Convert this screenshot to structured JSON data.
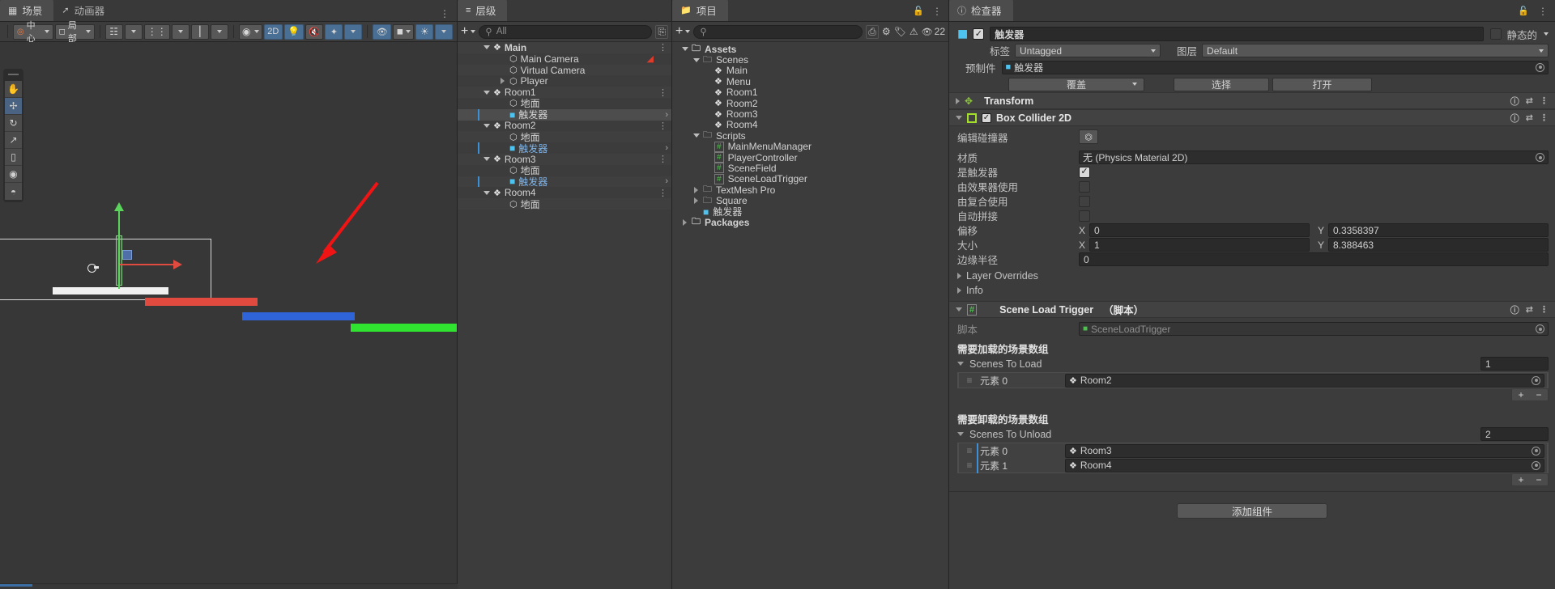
{
  "scene_panel": {
    "tabs": [
      {
        "label": "场景",
        "icon": "grid-icon",
        "active": true
      },
      {
        "label": "动画器",
        "icon": "animator-icon",
        "active": false
      }
    ],
    "toolbar": {
      "pivot_mode": "中心",
      "space_mode": "局部",
      "snap_label": "",
      "mode_2d": "2D",
      "count_badge": ""
    },
    "tools": [
      "hand-tool",
      "move-tool",
      "rotate-tool",
      "scale-tool",
      "rect-tool",
      "transform-tool",
      "custom-tool"
    ],
    "gizmo": {
      "axis_x_color": "#e04a3f",
      "axis_y_color": "#5ad45a",
      "cube_color": "#4f6fa8"
    },
    "platforms": [
      {
        "name": "red-platform",
        "color": "#e04a3f"
      },
      {
        "name": "blue-platform",
        "color": "#2f64d8"
      },
      {
        "name": "green-platform",
        "color": "#31e331"
      }
    ],
    "annotation_arrow_color": "#f01414"
  },
  "hierarchy": {
    "tab_label": "层级",
    "add_label": "+",
    "search_placeholder": "All",
    "items": [
      {
        "label": "Main",
        "depth": 1,
        "icon": "unity-scene-icon",
        "expanded": true,
        "bold": true,
        "kebab": true,
        "selected": false,
        "marker": false,
        "blue": false
      },
      {
        "label": "Main Camera",
        "depth": 2,
        "icon": "gameobject-icon",
        "expanded": null,
        "bold": false,
        "kebab": false,
        "selected": false,
        "marker": false,
        "blue": false,
        "badge": "camera-audio-icon"
      },
      {
        "label": "Virtual Camera",
        "depth": 2,
        "icon": "gameobject-icon",
        "expanded": null,
        "bold": false,
        "kebab": false,
        "selected": false,
        "marker": false,
        "blue": false
      },
      {
        "label": "Player",
        "depth": 2,
        "icon": "gameobject-icon",
        "expanded": false,
        "bold": false,
        "kebab": false,
        "selected": false,
        "marker": false,
        "blue": false
      },
      {
        "label": "Room1",
        "depth": 1,
        "icon": "unity-scene-icon",
        "expanded": true,
        "bold": false,
        "kebab": true,
        "selected": false,
        "marker": false,
        "blue": false
      },
      {
        "label": "地面",
        "depth": 2,
        "icon": "gameobject-icon",
        "expanded": null,
        "bold": false,
        "kebab": false,
        "selected": false,
        "marker": false,
        "blue": false
      },
      {
        "label": "触发器",
        "depth": 2,
        "icon": "prefab-icon",
        "expanded": null,
        "bold": false,
        "kebab": false,
        "selected": true,
        "marker": true,
        "blue": false,
        "chevron_right": true
      },
      {
        "label": "Room2",
        "depth": 1,
        "icon": "unity-scene-icon",
        "expanded": true,
        "bold": false,
        "kebab": true,
        "selected": false,
        "marker": false,
        "blue": false
      },
      {
        "label": "地面",
        "depth": 2,
        "icon": "gameobject-icon",
        "expanded": null,
        "bold": false,
        "kebab": false,
        "selected": false,
        "marker": false,
        "blue": false
      },
      {
        "label": "触发器",
        "depth": 2,
        "icon": "prefab-icon",
        "expanded": null,
        "bold": false,
        "kebab": false,
        "selected": false,
        "marker": true,
        "blue": true,
        "chevron_right": true
      },
      {
        "label": "Room3",
        "depth": 1,
        "icon": "unity-scene-icon",
        "expanded": true,
        "bold": false,
        "kebab": true,
        "selected": false,
        "marker": false,
        "blue": false
      },
      {
        "label": "地面",
        "depth": 2,
        "icon": "gameobject-icon",
        "expanded": null,
        "bold": false,
        "kebab": false,
        "selected": false,
        "marker": false,
        "blue": false
      },
      {
        "label": "触发器",
        "depth": 2,
        "icon": "prefab-icon",
        "expanded": null,
        "bold": false,
        "kebab": false,
        "selected": false,
        "marker": true,
        "blue": true,
        "chevron_right": true
      },
      {
        "label": "Room4",
        "depth": 1,
        "icon": "unity-scene-icon",
        "expanded": true,
        "bold": false,
        "kebab": true,
        "selected": false,
        "marker": false,
        "blue": false
      },
      {
        "label": "地面",
        "depth": 2,
        "icon": "gameobject-icon",
        "expanded": null,
        "bold": false,
        "kebab": false,
        "selected": false,
        "marker": false,
        "blue": false
      }
    ]
  },
  "project": {
    "tab_label": "项目",
    "add_label": "+",
    "search_placeholder": "",
    "badge_count": "22",
    "items": [
      {
        "label": "Assets",
        "depth": 0,
        "icon": "folder-icon",
        "expanded": true,
        "bold": true
      },
      {
        "label": "Scenes",
        "depth": 1,
        "icon": "folder-icon",
        "expanded": true,
        "bold": false
      },
      {
        "label": "Main",
        "depth": 2,
        "icon": "unity-scene-icon",
        "expanded": null,
        "bold": false
      },
      {
        "label": "Menu",
        "depth": 2,
        "icon": "unity-scene-icon",
        "expanded": null,
        "bold": false
      },
      {
        "label": "Room1",
        "depth": 2,
        "icon": "unity-scene-icon",
        "expanded": null,
        "bold": false
      },
      {
        "label": "Room2",
        "depth": 2,
        "icon": "unity-scene-icon",
        "expanded": null,
        "bold": false
      },
      {
        "label": "Room3",
        "depth": 2,
        "icon": "unity-scene-icon",
        "expanded": null,
        "bold": false
      },
      {
        "label": "Room4",
        "depth": 2,
        "icon": "unity-scene-icon",
        "expanded": null,
        "bold": false
      },
      {
        "label": "Scripts",
        "depth": 1,
        "icon": "folder-icon",
        "expanded": true,
        "bold": false
      },
      {
        "label": "MainMenuManager",
        "depth": 2,
        "icon": "script-icon",
        "expanded": null,
        "bold": false
      },
      {
        "label": "PlayerController",
        "depth": 2,
        "icon": "script-icon",
        "expanded": null,
        "bold": false
      },
      {
        "label": "SceneField",
        "depth": 2,
        "icon": "script-icon",
        "expanded": null,
        "bold": false
      },
      {
        "label": "SceneLoadTrigger",
        "depth": 2,
        "icon": "script-icon",
        "expanded": null,
        "bold": false
      },
      {
        "label": "TextMesh Pro",
        "depth": 1,
        "icon": "folder-icon",
        "expanded": false,
        "bold": false
      },
      {
        "label": "Square",
        "depth": 1,
        "icon": "folder-icon",
        "expanded": false,
        "bold": false
      },
      {
        "label": "触发器",
        "depth": 1,
        "icon": "prefab-icon",
        "expanded": null,
        "bold": false
      },
      {
        "label": "Packages",
        "depth": 0,
        "icon": "folder-icon",
        "expanded": false,
        "bold": true
      }
    ]
  },
  "inspector": {
    "tab_label": "检查器",
    "object": {
      "enabled": true,
      "name": "触发器",
      "static_label": "静态的",
      "static_checked": false,
      "tag_label": "标签",
      "tag_value": "Untagged",
      "layer_label": "图层",
      "layer_value": "Default",
      "prefab_label": "预制件",
      "prefab_value": "触发器",
      "overrides_label": "覆盖",
      "select_label": "选择",
      "open_label": "打开"
    },
    "transform": {
      "title": "Transform",
      "expanded": false
    },
    "box_collider": {
      "title": "Box Collider 2D",
      "enabled": true,
      "expanded": true,
      "edit_collider_label": "编辑碰撞器",
      "material_label": "材质",
      "material_value": "无 (Physics Material 2D)",
      "is_trigger_label": "是触发器",
      "is_trigger_checked": true,
      "used_by_effector_label": "由效果器使用",
      "used_by_effector_checked": false,
      "used_by_composite_label": "由复合使用",
      "used_by_composite_checked": false,
      "auto_tiling_label": "自动拼接",
      "auto_tiling_checked": false,
      "offset_label": "偏移",
      "offset_x": "0",
      "offset_y": "0.3358397",
      "size_label": "大小",
      "size_x": "1",
      "size_y": "8.388463",
      "edge_radius_label": "边缘半径",
      "edge_radius_value": "0",
      "layer_overrides_label": "Layer Overrides",
      "info_label": "Info"
    },
    "scene_load_trigger": {
      "title": "Scene Load Trigger",
      "title_suffix": "（脚本）",
      "expanded": true,
      "script_label": "脚本",
      "script_value": "SceneLoadTrigger",
      "load_section_title": "需要加载的场景数组",
      "load_array_label": "Scenes To Load",
      "load_array_size": "1",
      "load_elements": [
        {
          "label": "元素 0",
          "value": "Room2",
          "marker": false
        }
      ],
      "unload_section_title": "需要卸载的场景数组",
      "unload_array_label": "Scenes To Unload",
      "unload_array_size": "2",
      "unload_elements": [
        {
          "label": "元素 0",
          "value": "Room3",
          "marker": true
        },
        {
          "label": "元素 1",
          "value": "Room4",
          "marker": true
        }
      ],
      "plus_label": "+",
      "minus_label": "−"
    },
    "add_component_label": "添加组件"
  }
}
